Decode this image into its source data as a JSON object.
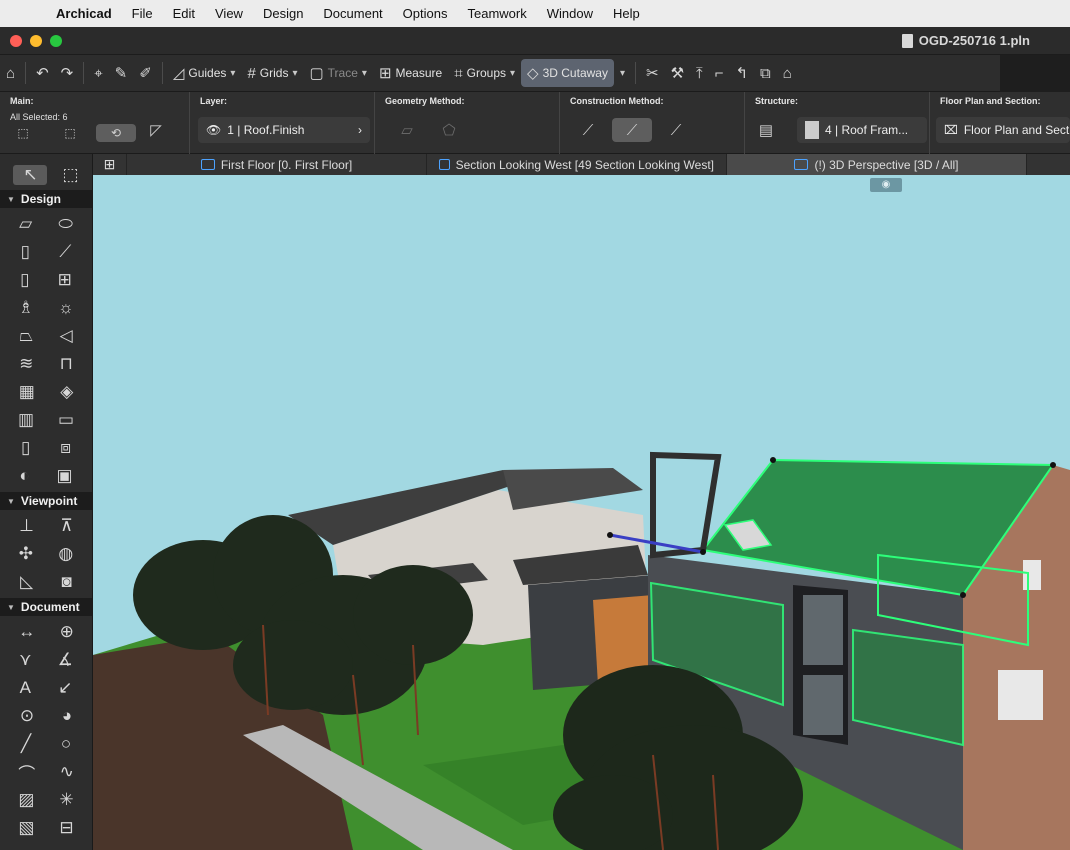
{
  "menubar": {
    "items": [
      "Archicad",
      "File",
      "Edit",
      "View",
      "Design",
      "Document",
      "Options",
      "Teamwork",
      "Window",
      "Help"
    ]
  },
  "window": {
    "title": "OGD-250716 1.pln"
  },
  "toolbar": {
    "guides_label": "Guides",
    "grids_label": "Grids",
    "trace_label": "Trace",
    "measure_label": "Measure",
    "groups_label": "Groups",
    "cutaway_label": "3D Cutaway"
  },
  "infobox": {
    "main_title": "Main:",
    "selected_text": "All Selected: 6",
    "layer_title": "Layer:",
    "layer_value": "1 | Roof.Finish",
    "geometry_title": "Geometry Method:",
    "construction_title": "Construction Method:",
    "structure_title": "Structure:",
    "structure_value": "4 | Roof Fram...",
    "floorplan_title": "Floor Plan and Section:",
    "floorplan_value": "Floor Plan and Section..."
  },
  "tabs": [
    {
      "label": "First Floor [0. First Floor]"
    },
    {
      "label": "Section Looking West [49 Section Looking West]"
    },
    {
      "label": "(!) 3D Perspective [3D / All]"
    }
  ],
  "toolbox": {
    "design_label": "Design",
    "viewpoint_label": "Viewpoint",
    "document_label": "Document"
  },
  "colors": {
    "sky": "#a2d8e2",
    "grass": "#3f8f2e",
    "roof_selected": "#2c8d4c",
    "selection_outline": "#2dff7a",
    "accent_blue": "#4da3ff"
  }
}
